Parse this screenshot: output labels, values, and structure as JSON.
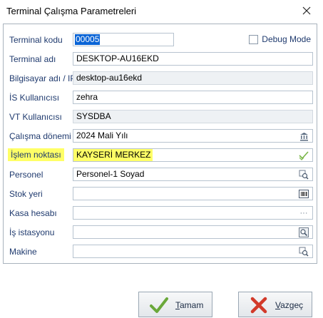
{
  "window": {
    "title": "Terminal Çalışma Parametreleri"
  },
  "form": {
    "terminal_kodu": {
      "label": "Terminal kodu",
      "value": "00005"
    },
    "debug_mode": {
      "label": "Debug Mode",
      "checked": false
    },
    "terminal_adi": {
      "label": "Terminal adı",
      "value": "DESKTOP-AU16EKD"
    },
    "bilgisayar_adi": {
      "label": "Bilgisayar adı / IP",
      "value": "desktop-au16ekd"
    },
    "is_kullanicisi": {
      "label": "İS Kullanıcısı",
      "value": "zehra"
    },
    "vt_kullanicisi": {
      "label": "VT Kullanıcısı",
      "value": "SYSDBA"
    },
    "calisma_donemi": {
      "label": "Çalışma dönemi",
      "value": "2024 Mali Yılı"
    },
    "islem_noktasi": {
      "label": "İşlem noktası",
      "value": "KAYSERİ MERKEZ"
    },
    "personel": {
      "label": "Personel",
      "value": "Personel-1 Soyad"
    },
    "stok_yeri": {
      "label": "Stok yeri",
      "value": ""
    },
    "kasa_hesabi": {
      "label": "Kasa hesabı",
      "value": ""
    },
    "is_istasyonu": {
      "label": "İş istasyonu",
      "value": ""
    },
    "makine": {
      "label": "Makine",
      "value": ""
    }
  },
  "buttons": {
    "ok": {
      "label_first": "T",
      "label_rest": "amam"
    },
    "cancel": {
      "label_first": "V",
      "label_rest": "azgeç"
    }
  },
  "colors": {
    "highlight": "#ffff66",
    "label_text": "#1f3a6e",
    "selection": "#0a64d6"
  },
  "icons": [
    "close-icon",
    "bank-icon",
    "check-icon",
    "lookup-icon",
    "barcode-icon",
    "ellipsis-icon",
    "search-icon",
    "ok-check-icon",
    "cancel-x-icon"
  ]
}
